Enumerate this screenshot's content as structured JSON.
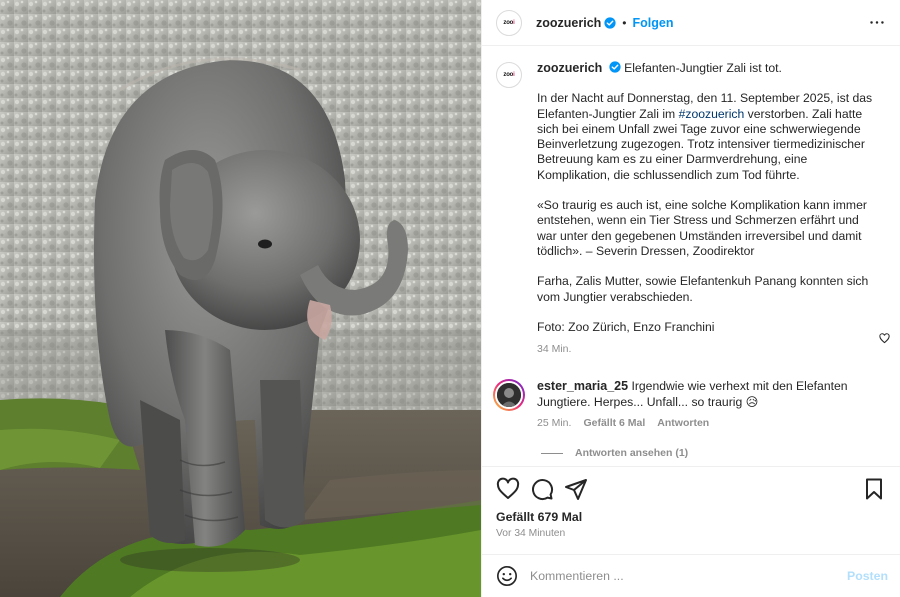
{
  "header": {
    "username": "zoozuerich",
    "separator": "•",
    "follow_label": "Folgen",
    "avatar_text": "zoo",
    "avatar_dot": "i"
  },
  "caption": {
    "username": "zoozuerich",
    "headline": "Elefanten-Jungtier Zali ist tot.",
    "p1_before": "In der Nacht auf Donnerstag, den 11. September 2025, ist das Elefanten-Jungtier Zali im ",
    "p1_hashtag": "#zoozuerich",
    "p1_after": " verstorben. Zali hatte sich bei einem Unfall zwei Tage zuvor eine schwerwiegende Beinverletzung zugezogen. Trotz intensiver tiermedizinischer Betreuung kam es zu einer Darmverdrehung, eine Komplikation, die schlussendlich zum Tod führte.",
    "p2": "«So traurig es auch ist, eine solche Komplikation kann immer entstehen, wenn ein Tier Stress und Schmerzen erfährt und war unter den gegebenen Umständen irreversibel und damit tödlich». – Severin Dressen, Zoodirektor",
    "p3": "Farha, Zalis Mutter, sowie Elefantenkuh Panang konnten sich vom Jungtier verabschieden.",
    "p4": "Foto: Zoo Zürich, Enzo Franchini",
    "timestamp": "34 Min."
  },
  "comment": {
    "username": "ester_maria_25",
    "text": "Irgendwie wie verhext mit den Elefanten Jungtiere. Herpes... Unfall... so traurig",
    "emoji": "😥",
    "time": "25 Min.",
    "likes": "Gefällt 6 Mal",
    "reply": "Antworten",
    "view_replies": "Antworten ansehen (1)"
  },
  "actions": {
    "likes": "Gefällt 679 Mal",
    "posted_ago": "Vor 34 Minuten"
  },
  "composer": {
    "placeholder": "Kommentieren ...",
    "post_label": "Posten"
  },
  "icons": [
    "verified-icon",
    "more-icon",
    "heart-icon",
    "comment-icon",
    "share-icon",
    "bookmark-icon",
    "emoji-icon",
    "comment-heart-icon"
  ],
  "colors": {
    "accent": "#0095f6",
    "hashtag": "#00376b",
    "muted": "#8e8e8e",
    "post_disabled": "#b2dffc"
  }
}
